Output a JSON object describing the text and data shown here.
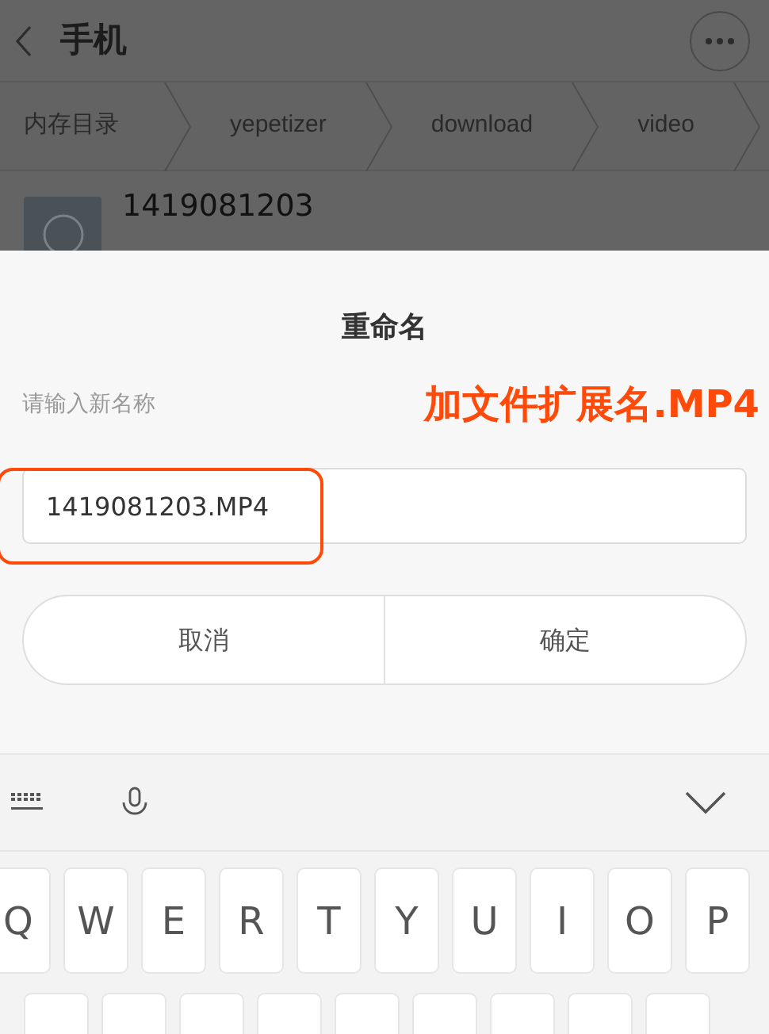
{
  "header": {
    "title": "手机"
  },
  "breadcrumb": [
    {
      "label": "内存目录"
    },
    {
      "label": "yepetizer"
    },
    {
      "label": "download"
    },
    {
      "label": "video"
    }
  ],
  "file": {
    "name": "1419081203"
  },
  "dialog": {
    "title": "重命名",
    "prompt": "请输入新名称",
    "value": "1419081203.MP4",
    "buttons": [
      "取消",
      "确定"
    ]
  },
  "annotation": {
    "text": "加文件扩展名.MP4",
    "color": "#ff4a0a"
  },
  "keyboard": {
    "row_1": [
      "Q",
      "W",
      "E",
      "R",
      "T",
      "Y",
      "U",
      "I",
      "O",
      "P"
    ]
  }
}
